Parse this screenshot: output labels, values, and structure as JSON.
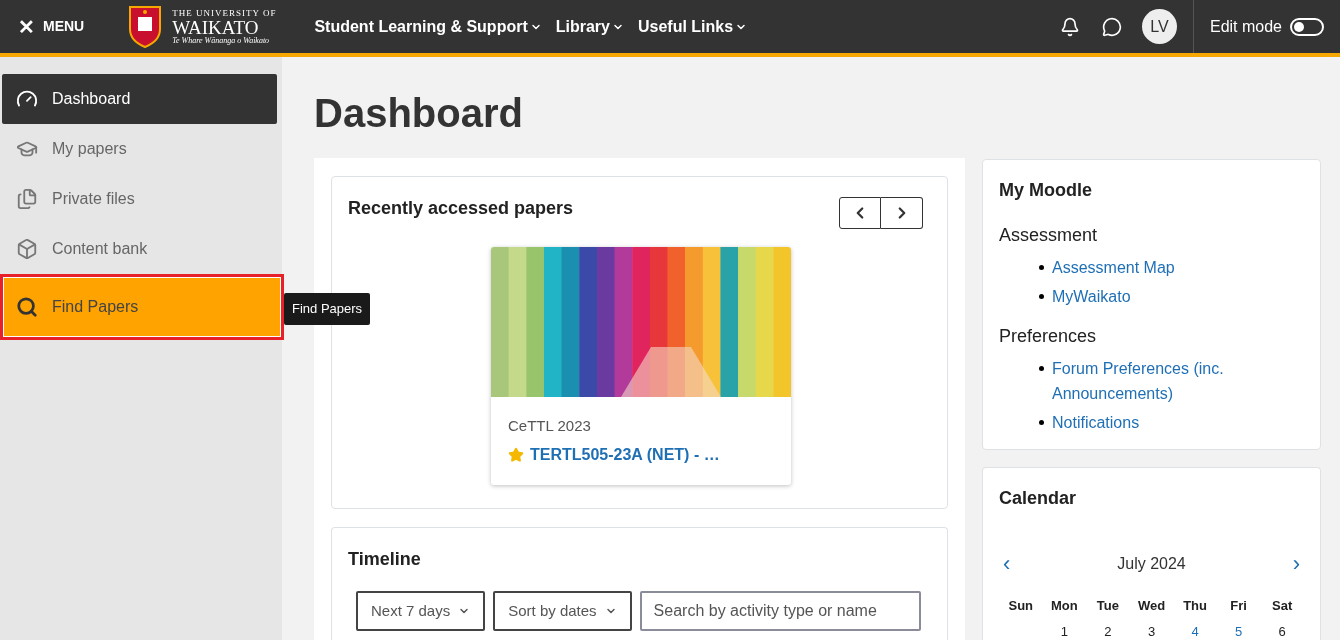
{
  "header": {
    "menu": {
      "icon": "✕",
      "label": "MENU"
    },
    "logo": {
      "line_1": "THE UNIVERSITY OF",
      "line_2": "WAIKATO",
      "line_3": "Te Whare Wānanga o Waikato"
    },
    "nav": [
      {
        "label": "Student Learning & Support"
      },
      {
        "label": "Library"
      },
      {
        "label": "Useful Links"
      }
    ],
    "avatar": "LV",
    "edit_mode": {
      "label": "Edit mode",
      "on": false
    }
  },
  "sidebar": {
    "items": [
      {
        "kind": "gauge",
        "label": "Dashboard",
        "selected": true,
        "hovered": false
      },
      {
        "kind": "cap",
        "label": "My papers",
        "selected": false,
        "hovered": false
      },
      {
        "kind": "files",
        "label": "Private files",
        "selected": false,
        "hovered": false
      },
      {
        "kind": "cube",
        "label": "Content bank",
        "selected": false,
        "hovered": false
      },
      {
        "kind": "search",
        "label": "Find Papers",
        "selected": false,
        "hovered": true
      }
    ],
    "tooltip": "Find Papers"
  },
  "page_title": "Dashboard",
  "recent": {
    "title": "Recently accessed papers",
    "card": {
      "category": "CeTTL 2023",
      "name": "TERTL505-23A (NET) - …",
      "starred": true
    }
  },
  "timeline": {
    "title": "Timeline",
    "filters": [
      "Next 7 days",
      "Sort by dates"
    ],
    "search": {
      "placeholder": "Search by activity type or name"
    }
  },
  "my_moodle": {
    "title": "My Moodle",
    "sections": [
      {
        "heading": "Assessment",
        "links": [
          "Assessment Map",
          "MyWaikato"
        ]
      },
      {
        "heading": "Preferences",
        "links": [
          "Forum Preferences (inc. Announcements)",
          "Notifications"
        ]
      }
    ]
  },
  "calendar": {
    "title": "Calendar",
    "month": "July 2024",
    "prev": "‹",
    "next": "›",
    "weekdays": [
      "Sun",
      "Mon",
      "Tue",
      "Wed",
      "Thu",
      "Fri",
      "Sat"
    ],
    "days": [
      {
        "label": "1",
        "has_events": false
      },
      {
        "label": "2",
        "has_events": false
      },
      {
        "label": "3",
        "has_events": false
      },
      {
        "label": "4",
        "has_events": true
      },
      {
        "label": "5",
        "has_events": true
      },
      {
        "label": "6",
        "has_events": false
      }
    ]
  }
}
